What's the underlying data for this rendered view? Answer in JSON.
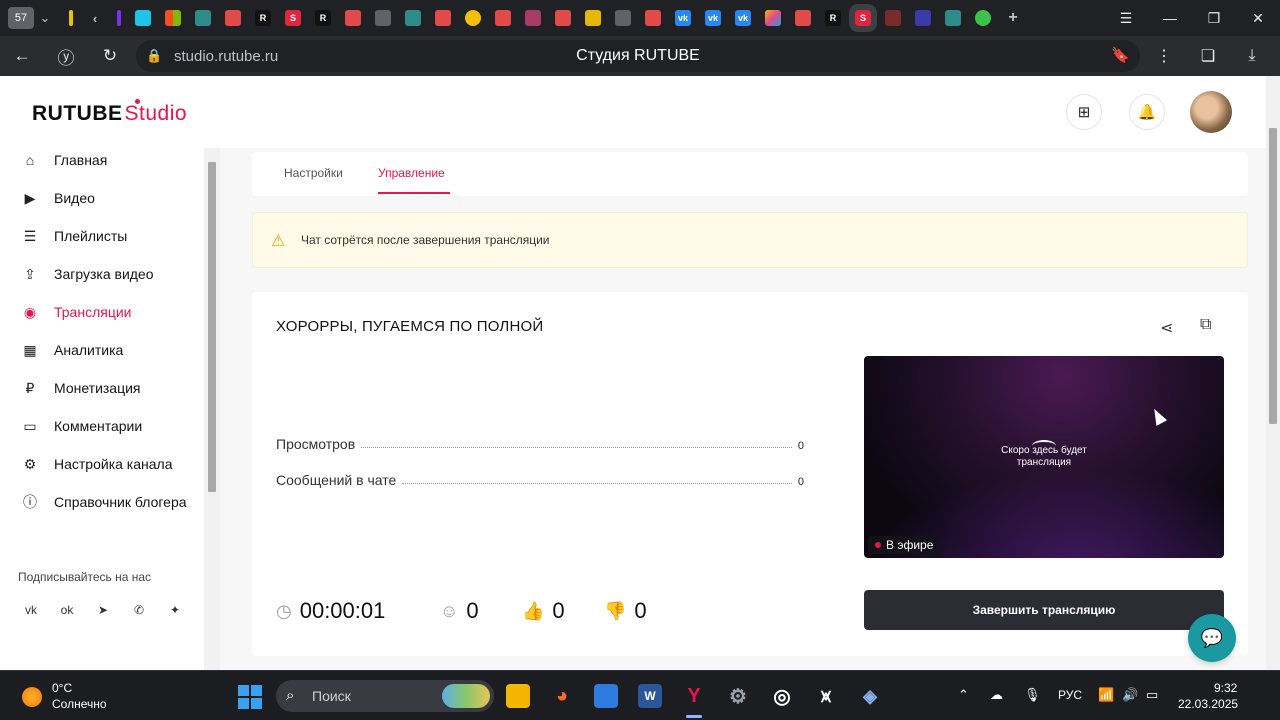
{
  "browser": {
    "tab_count": "57",
    "url": "studio.rutube.ru",
    "page_title": "Студия RUTUBE"
  },
  "app": {
    "logo_main": "RUTUBE",
    "logo_sub": "Studio"
  },
  "sidebar": {
    "items": [
      {
        "label": "Главная"
      },
      {
        "label": "Видео"
      },
      {
        "label": "Плейлисты"
      },
      {
        "label": "Загрузка видео"
      },
      {
        "label": "Трансляции"
      },
      {
        "label": "Аналитика"
      },
      {
        "label": "Монетизация"
      },
      {
        "label": "Комментарии"
      },
      {
        "label": "Настройка канала"
      },
      {
        "label": "Справочник блогера"
      }
    ],
    "active": "Трансляции",
    "subscribe_label": "Подписывайтесь на нас"
  },
  "tabs": [
    {
      "label": "Настройки"
    },
    {
      "label": "Управление"
    }
  ],
  "active_tab": "Управление",
  "alert": {
    "text": "Чат сотрётся после завершения трансляции"
  },
  "stream": {
    "title": "ХОРОРРЫ, ПУГАЕМСЯ ПО ПОЛНОЙ",
    "stats": [
      {
        "label": "Просмотров",
        "value": "0"
      },
      {
        "label": "Сообщений в чате",
        "value": "0"
      }
    ],
    "player_message": "Скоро здесь будет трансляция",
    "live_label": "В эфире",
    "duration": "00:00:01",
    "viewers": "0",
    "likes": "0",
    "dislikes": "0",
    "end_button": "Завершить трансляцию"
  },
  "taskbar": {
    "weather_temp": "0°C",
    "weather_desc": "Солнечно",
    "search_placeholder": "Поиск",
    "language": "РУС",
    "time": "9:32",
    "date": "22.03.2025"
  },
  "colors": {
    "accent": "#e8144b",
    "dark_button": "#2a2d33",
    "alert_bg": "#fffbe8",
    "help_button": "#1a9aa0"
  }
}
